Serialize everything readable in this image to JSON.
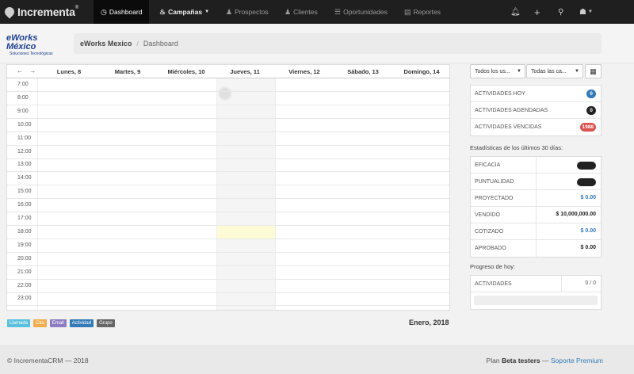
{
  "brand": {
    "name": "Incrementa",
    "mark": "®"
  },
  "nav": {
    "items": [
      {
        "label": "Dashboard",
        "icon": "dashboard-icon"
      },
      {
        "label": "Campañas",
        "icon": "fire-icon"
      },
      {
        "label": "Prospectos",
        "icon": "user-icon"
      },
      {
        "label": "Clientes",
        "icon": "users-icon"
      },
      {
        "label": "Oportunidades",
        "icon": "list-icon"
      },
      {
        "label": "Reportes",
        "icon": "chart-icon"
      }
    ],
    "right_icons": [
      "bell-icon",
      "plus-icon",
      "search-icon",
      "user-menu-icon"
    ]
  },
  "org": {
    "logo_line1": "eWorks México",
    "logo_line2": "Soluciones Tecnológicas"
  },
  "breadcrumb": {
    "items": [
      "eWorks Mexico",
      "Dashboard"
    ],
    "separator": "/"
  },
  "calendar": {
    "nav_prev": "←",
    "nav_next": "→",
    "days": [
      "Lunes, 8",
      "Martes, 9",
      "Miércoles, 10",
      "Jueves, 11",
      "Viernes, 12",
      "Sábado, 13",
      "Domingo, 14"
    ],
    "hours": [
      "7:00",
      "8:00",
      "9:00",
      "10:00",
      "11:00",
      "12:00",
      "13:00",
      "14:00",
      "15:00",
      "16:00",
      "17:00",
      "18:00",
      "19:00",
      "20:00",
      "21:00",
      "22:00",
      "23:00"
    ],
    "month": "Enero, 2018"
  },
  "legend": [
    {
      "label": "Llamada",
      "color": "#5bc0de"
    },
    {
      "label": "Cita",
      "color": "#f0ad4e"
    },
    {
      "label": "Email",
      "color": "#8e7cc3"
    },
    {
      "label": "Actividad",
      "color": "#337ab7"
    },
    {
      "label": "Grupo",
      "color": "#666666"
    }
  ],
  "filters": {
    "user": "Todos los us...",
    "campaign": "Todas las ca...",
    "calendar_icon": "calendar-icon"
  },
  "activity_counts": [
    {
      "label": "ACTIVIDADES HOY",
      "value": "0",
      "color": "#337ab7"
    },
    {
      "label": "ACTIVIDADES AGENDADAS",
      "value": "0",
      "color": "#222222"
    },
    {
      "label": "ACTIVIDADES VENCIDAS",
      "value": "1988",
      "color": "#d9534f"
    }
  ],
  "stats": {
    "title": "Estadísticas de los últimos 30 días:",
    "rows": [
      {
        "label": "EFICACIA",
        "value": ""
      },
      {
        "label": "PUNTUALIDAD",
        "value": ""
      },
      {
        "label": "PROYECTADO",
        "value": "$ 0.00"
      },
      {
        "label": "VENDIDO",
        "value": "$ 10,000,000.00"
      },
      {
        "label": "COTIZADO",
        "value": "$ 0.00"
      },
      {
        "label": "APROBADO",
        "value": "$ 0.00"
      }
    ]
  },
  "progress": {
    "title": "Progreso de hoy:",
    "label": "ACTIVIDADES",
    "value": "0 / 0",
    "fraction": 0
  },
  "footer": {
    "copyright": "© IncrementaCRM — 2018",
    "plan_prefix": "Plan",
    "plan_name": "Beta testers",
    "dash": "—",
    "support": "Soporte Premium"
  }
}
